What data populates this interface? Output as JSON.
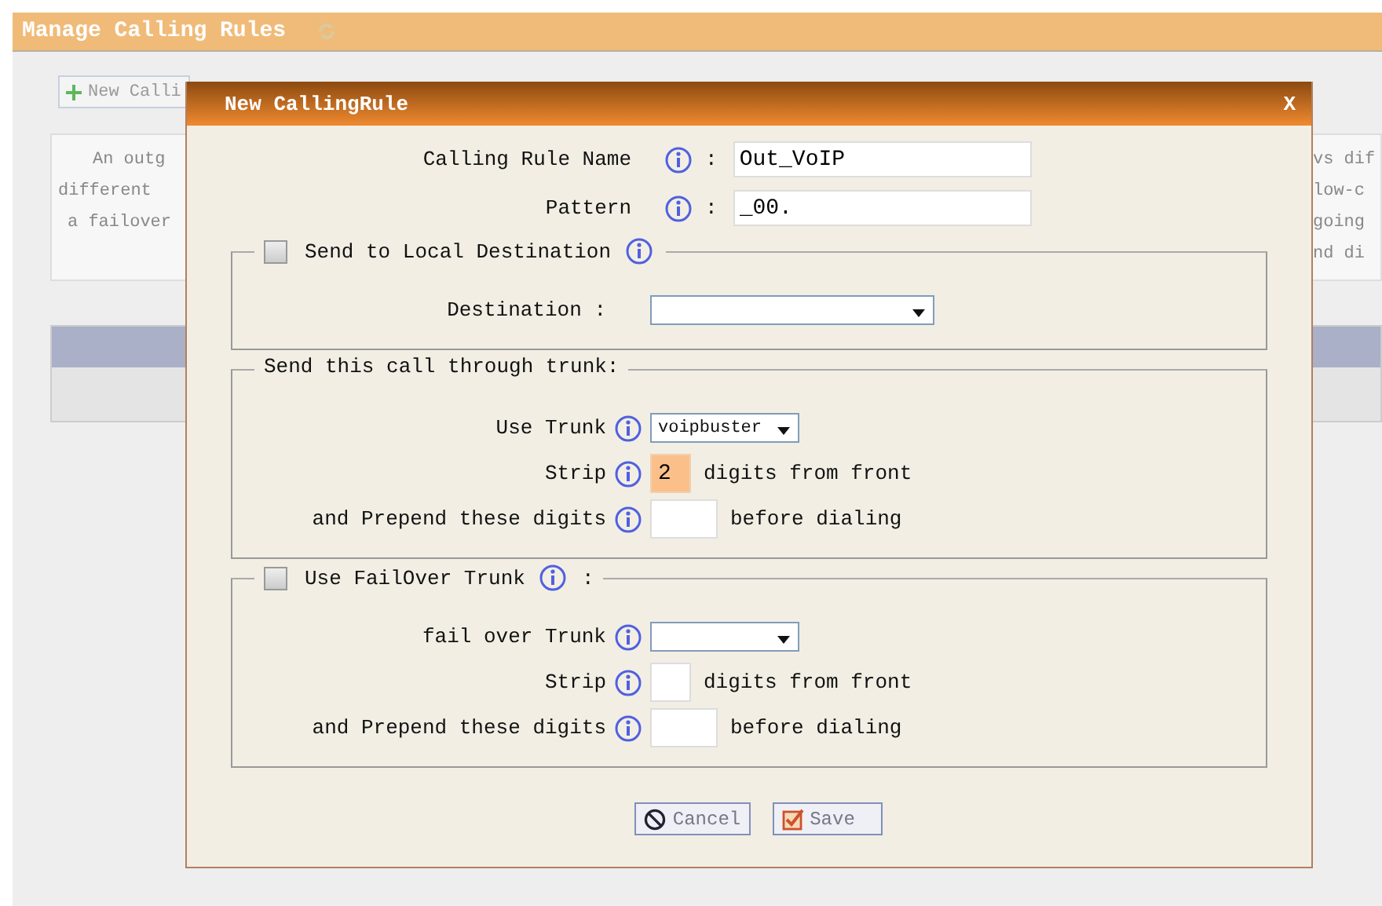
{
  "page": {
    "title": "Manage Calling Rules",
    "new_button": "New Calli",
    "intro_left": [
      "An outg",
      "different",
      "a failover"
    ],
    "intro_right": [
      "vs dif",
      "low-c",
      "going",
      "nd di"
    ]
  },
  "dialog": {
    "title": "New CallingRule",
    "close": "X",
    "fields": [
      {
        "label": "Calling Rule Name",
        "separator": ":",
        "value": "Out_VoIP"
      },
      {
        "label": "Pattern",
        "separator": ":",
        "value": "_00."
      }
    ],
    "sections": [
      {
        "kind": "checkbox",
        "legend": "Send to Local Destination",
        "checked": false,
        "info": true,
        "rows": [
          {
            "label": "Destination :",
            "info": false,
            "control": {
              "kind": "dropdown",
              "wide": true
            }
          }
        ]
      },
      {
        "kind": "plain",
        "legend": "Send this call through trunk:",
        "info": false,
        "rows": [
          {
            "label": "Use Trunk",
            "info": true,
            "control": {
              "kind": "dropdown",
              "wide": false,
              "value": "voipbuster"
            }
          },
          {
            "label": "Strip",
            "info": true,
            "control": {
              "kind": "input",
              "wide": false,
              "value": "2",
              "highlighted": true
            },
            "suffix": "digits from front"
          },
          {
            "label": "and Prepend these digits",
            "info": true,
            "control": {
              "kind": "input",
              "wide": true,
              "highlighted": false
            },
            "suffix": "before dialing"
          }
        ]
      },
      {
        "kind": "checkbox",
        "legend": "Use FailOver Trunk",
        "checked": false,
        "info": true,
        "legend_suffix": ":",
        "rows": [
          {
            "label": "fail over Trunk",
            "info": true,
            "control": {
              "kind": "dropdown",
              "wide": false
            }
          },
          {
            "label": "Strip",
            "info": true,
            "control": {
              "kind": "input",
              "wide": false,
              "highlighted": false
            },
            "suffix": "digits from front"
          },
          {
            "label": "and Prepend these digits",
            "info": true,
            "control": {
              "kind": "input",
              "wide": true,
              "highlighted": false
            },
            "suffix": "before dialing"
          }
        ]
      }
    ],
    "buttons": [
      {
        "kind": "cancel",
        "label": "Cancel"
      },
      {
        "kind": "save",
        "label": "Save"
      }
    ]
  }
}
